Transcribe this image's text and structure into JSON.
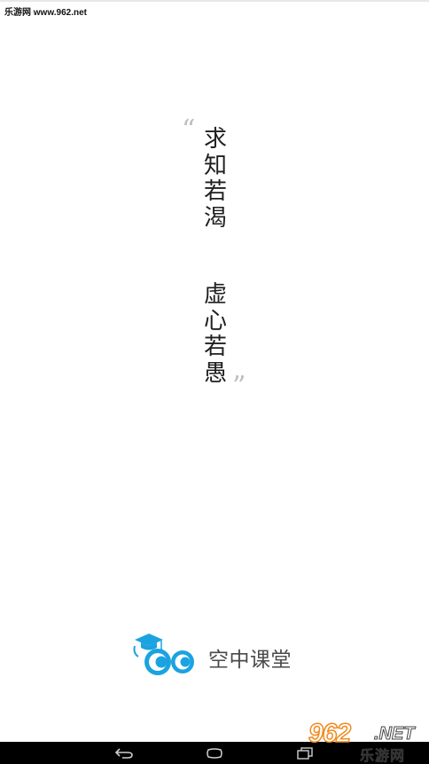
{
  "watermark_top": "乐游网 www.962.net",
  "quote": {
    "open_mark": "“",
    "close_mark": "”",
    "line1": "求知若渴",
    "line2": "虚心若愚"
  },
  "logo": {
    "text": "空中课堂",
    "icon": "owl-graduation-cap-icon",
    "brand_color": "#1aa3e0"
  },
  "nav_bar": {
    "back_icon": "back-icon",
    "home_icon": "home-icon",
    "recent_icon": "recent-apps-icon"
  },
  "watermark_bottom": {
    "number": "962",
    "domain": ".NET",
    "name": "乐游网"
  }
}
